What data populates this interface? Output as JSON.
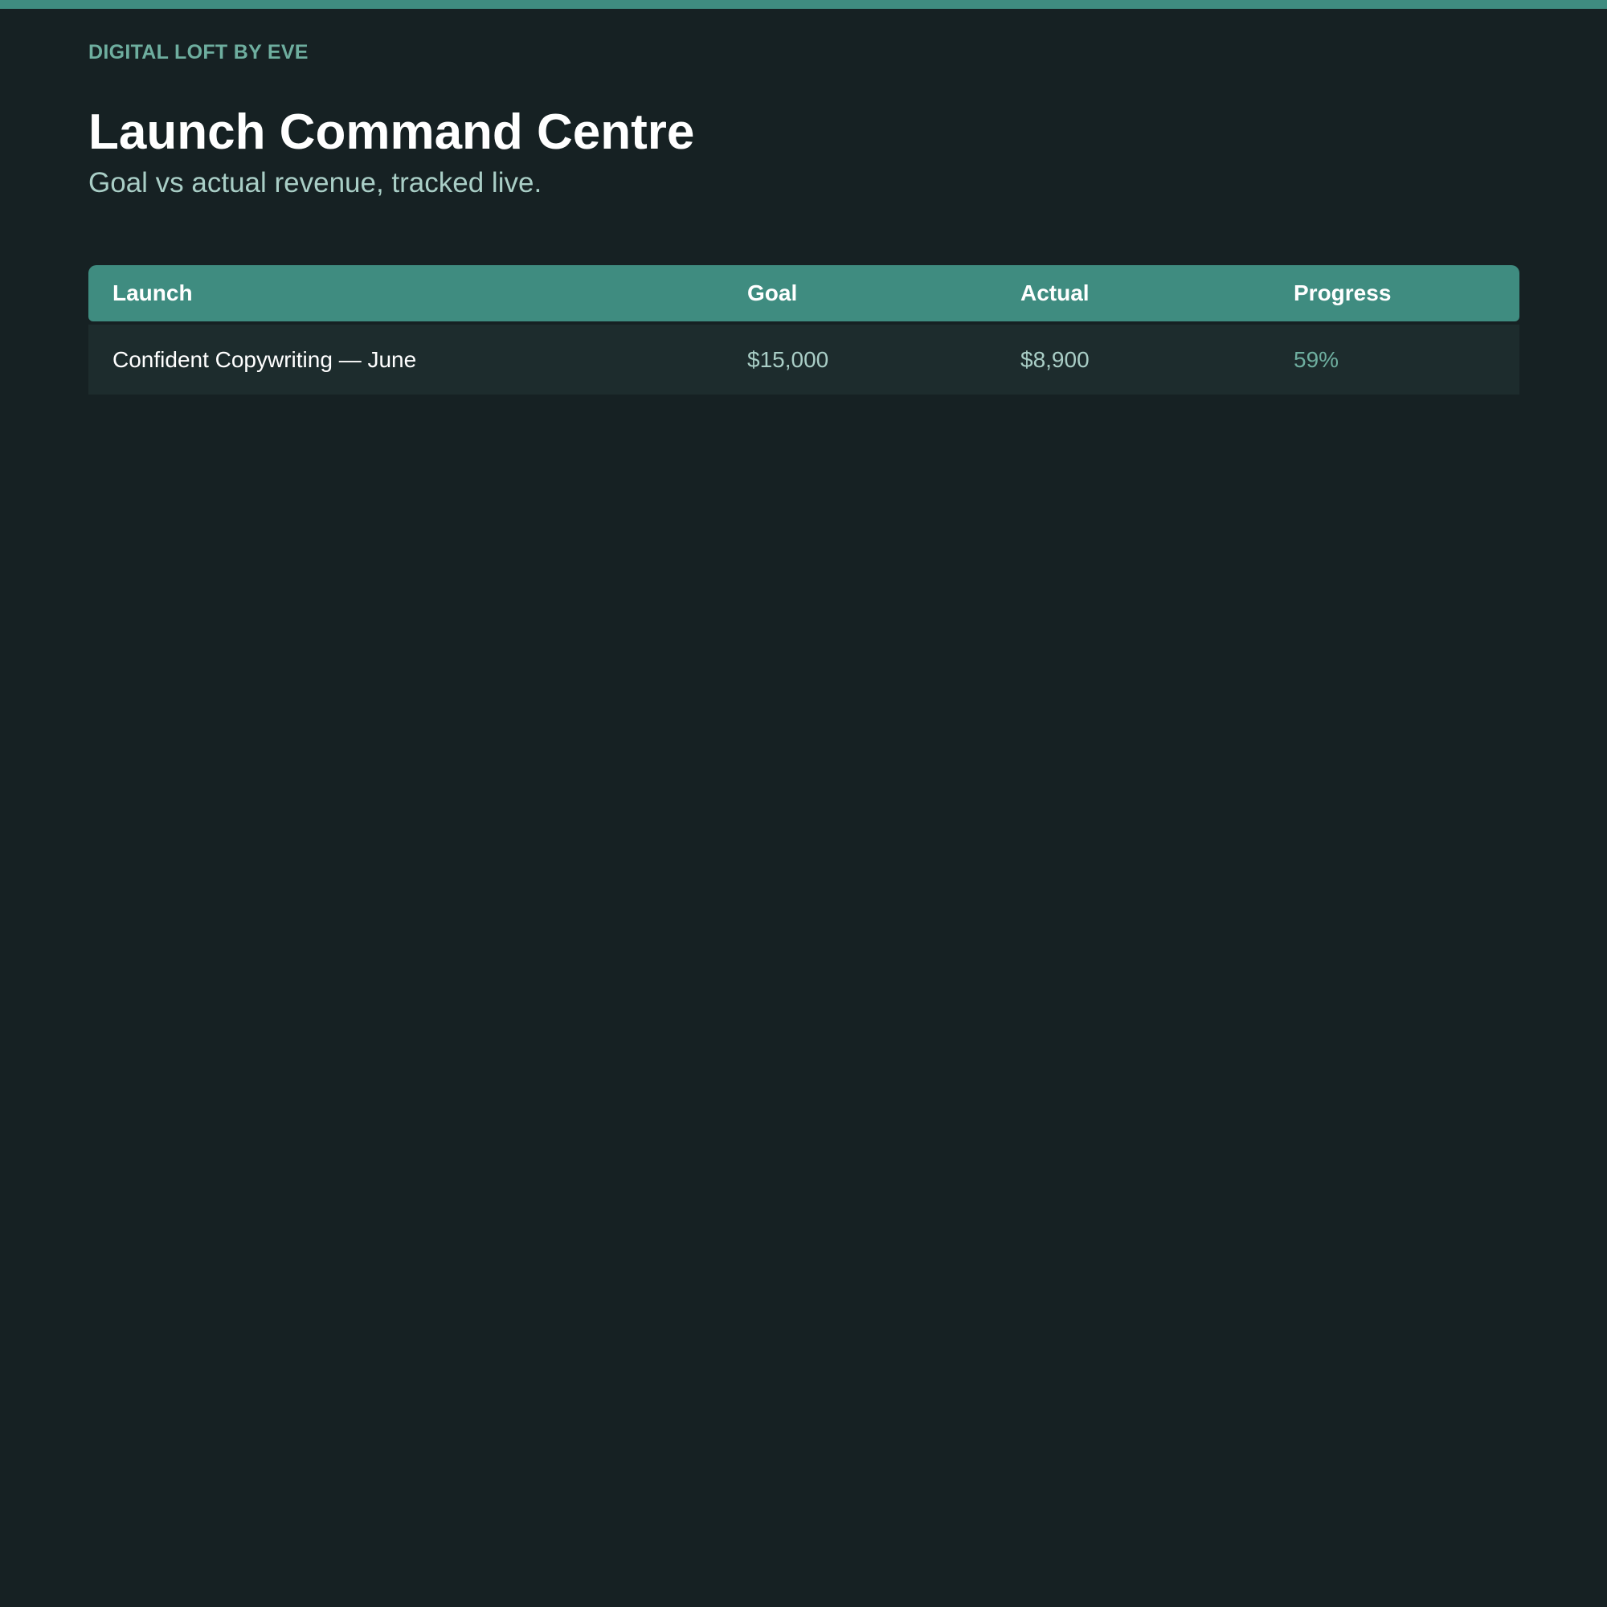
{
  "brand": "DIGITAL LOFT BY EVE",
  "header": {
    "title": "Launch Command Centre",
    "subtitle": "Goal vs actual revenue, tracked live."
  },
  "table": {
    "columns": [
      "Launch",
      "Goal",
      "Actual",
      "Progress"
    ],
    "rows": [
      {
        "launch": "Confident Copywriting — June",
        "goal": "$15,000",
        "actual": "$8,900",
        "progress": "59%"
      }
    ]
  },
  "colors": {
    "background": "#162123",
    "accent": "#3f8c80",
    "brand_text": "#6eae9f",
    "muted_text": "#a9cec6",
    "row_background": "#1d2c2d"
  }
}
